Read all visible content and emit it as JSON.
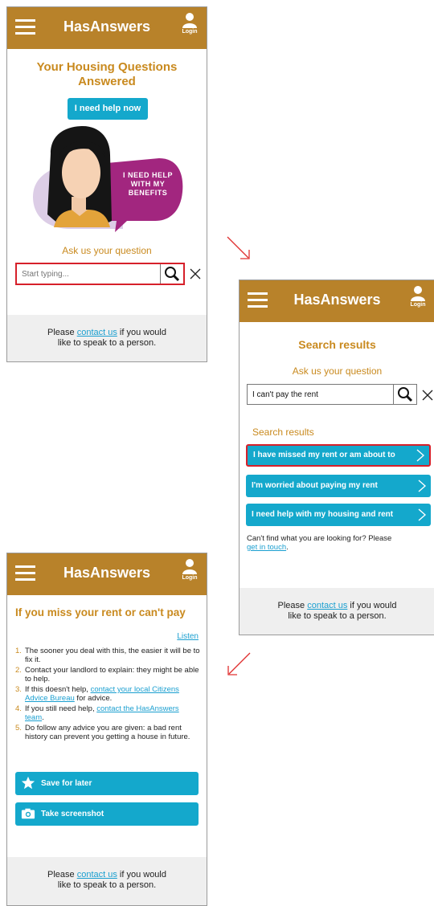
{
  "app": {
    "title": "HasAnswers",
    "login_label": "Login"
  },
  "footer": {
    "text_before": "Please ",
    "link": "contact us",
    "text_after_line1": " if you would",
    "text_line2": "like to speak to a person."
  },
  "home": {
    "heading_line1": "Your Housing Questions",
    "heading_line2": "Answered",
    "help_button": "I need help now",
    "bubble_line1": "I NEED HELP",
    "bubble_line2": "WITH MY",
    "bubble_line3": "BENEFITS",
    "ask_label": "Ask us your question",
    "search_placeholder": "Start typing..."
  },
  "results": {
    "heading": "Search results",
    "ask_label": "Ask us your question",
    "search_value": "I can't pay the rent",
    "results_label": "Search results",
    "items": [
      {
        "label": "I have missed my rent or am about to"
      },
      {
        "label": "I'm worried about paying my rent"
      },
      {
        "label": "I need help with my housing and rent"
      }
    ],
    "cant_find": "Can't find what you are looking for? Please",
    "get_in_touch": "get in touch",
    "period": "."
  },
  "article": {
    "title": "If you miss your rent or can't pay",
    "listen": "Listen",
    "steps": [
      {
        "n": "1.",
        "text": "The sooner you deal with this, the easier it will be to fix it."
      },
      {
        "n": "2.",
        "text": "Contact your landlord to explain: they might be able to help."
      },
      {
        "n": "3.",
        "pre": "If this doesn't help, ",
        "link": "contact your local Citizens Advice Bureau",
        "post": " for advice."
      },
      {
        "n": "4.",
        "pre": "If you still need help, ",
        "link": "contact the HasAnswers team",
        "post": "."
      },
      {
        "n": "5.",
        "text": "Do follow any advice you are given: a bad rent history can prevent you getting a house in future."
      }
    ],
    "save_button": "Save for later",
    "screenshot_button": "Take screenshot"
  },
  "colors": {
    "header": "#b8822a",
    "accent": "#14a8cc",
    "heading": "#c98a1f",
    "highlight": "#d6202a",
    "bubble": "#a2267f"
  },
  "icons": [
    "menu-icon",
    "user-icon",
    "search-icon",
    "close-icon",
    "chevron-right-icon",
    "star-icon",
    "camera-icon",
    "arrow-icon"
  ]
}
